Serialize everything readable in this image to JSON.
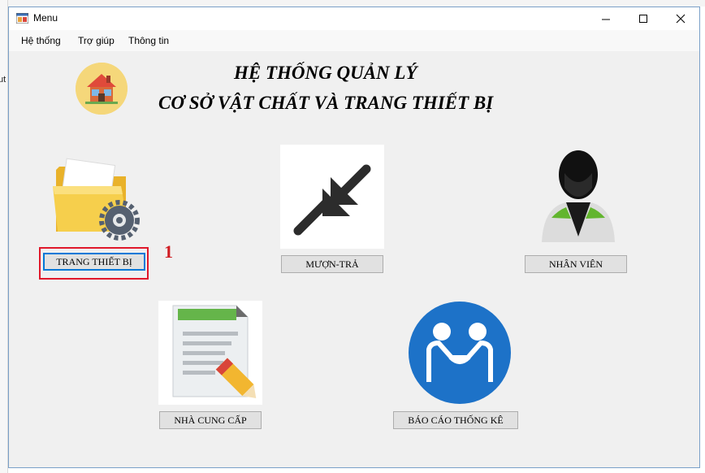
{
  "background": {
    "fragment": "ut"
  },
  "window": {
    "title": "Menu",
    "controls": {
      "minimize": "minimize",
      "maximize": "maximize",
      "close": "close"
    }
  },
  "menu": [
    "Hệ thống",
    "Trợ giúp",
    "Thông tin"
  ],
  "heading": {
    "line1": "HỆ THỐNG QUẢN LÝ",
    "line2": "CƠ SỞ VẬT CHẤT VÀ TRANG THIẾT BỊ"
  },
  "tiles": [
    {
      "label": "TRANG THIẾT BỊ",
      "icon": "folder-gear-icon"
    },
    {
      "label": "MƯỢN-TRẢ",
      "icon": "arrows-in-icon"
    },
    {
      "label": "NHÂN VIÊN",
      "icon": "person-icon"
    },
    {
      "label": "NHÀ CUNG CẤP",
      "icon": "document-pencil-icon"
    },
    {
      "label": "BÁO CÁO THỐNG KÊ",
      "icon": "handshake-icon"
    }
  ],
  "annotation": {
    "marker": "1",
    "color": "#e0182a"
  },
  "colors": {
    "accent": "#0078d7",
    "menu_bg": "#f0f0f0"
  }
}
